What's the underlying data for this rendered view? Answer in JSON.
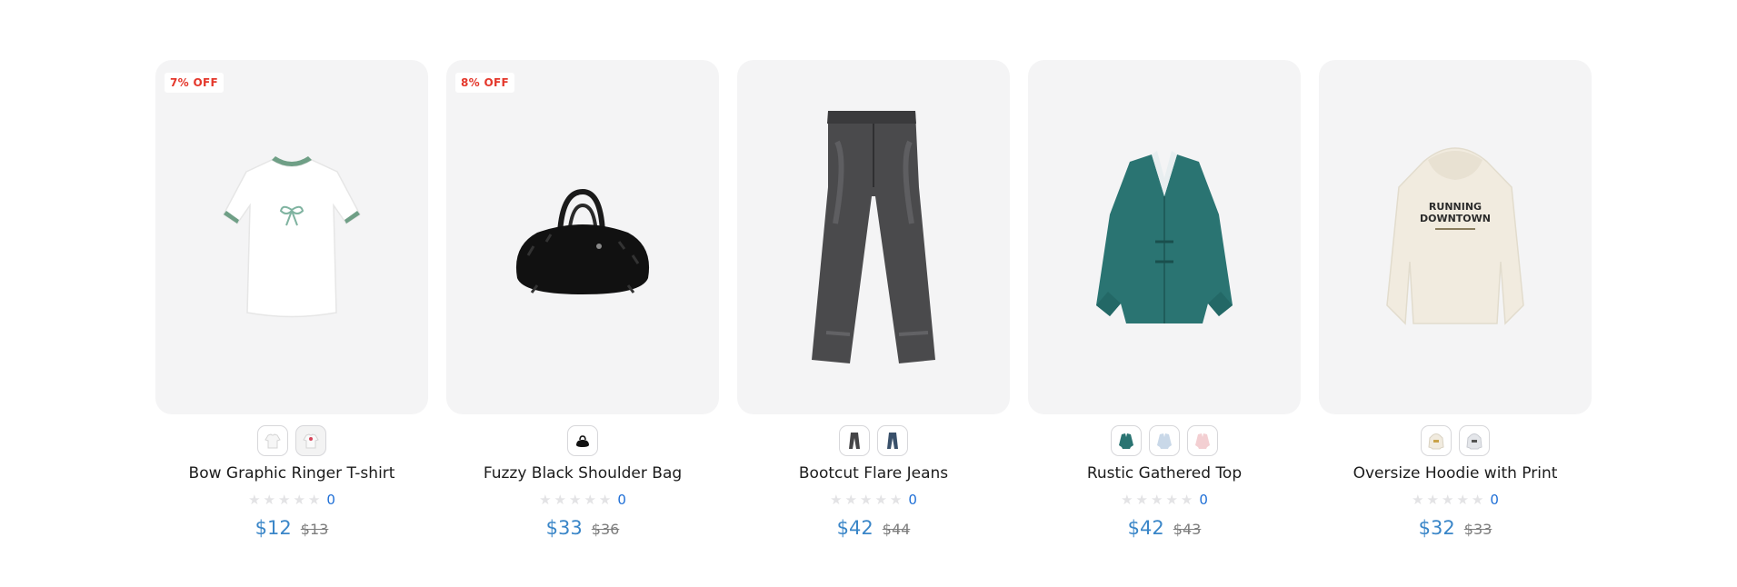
{
  "products": [
    {
      "badge": "7% OFF",
      "title": "Bow Graphic Ringer T-shirt",
      "rating_count": "0",
      "price": "$12",
      "old_price": "$13",
      "swatches": [
        "white-tshirt-swatch-icon",
        "white-print-tshirt-swatch-icon"
      ]
    },
    {
      "badge": "8% OFF",
      "title": "Fuzzy Black Shoulder Bag",
      "rating_count": "0",
      "price": "$33",
      "old_price": "$36",
      "swatches": [
        "black-bag-swatch-icon"
      ]
    },
    {
      "badge": "",
      "title": "Bootcut Flare Jeans",
      "rating_count": "0",
      "price": "$42",
      "old_price": "$44",
      "swatches": [
        "grey-jeans-swatch-icon",
        "blue-jeans-swatch-icon"
      ]
    },
    {
      "badge": "",
      "title": "Rustic Gathered Top",
      "rating_count": "0",
      "price": "$42",
      "old_price": "$43",
      "swatches": [
        "teal-top-swatch-icon",
        "light-blue-top-swatch-icon",
        "pink-top-swatch-icon"
      ]
    },
    {
      "badge": "",
      "title": "Oversize Hoodie with Print",
      "rating_count": "0",
      "price": "$32",
      "old_price": "$33",
      "swatches": [
        "cream-hoodie-swatch-icon",
        "grey-hoodie-swatch-icon"
      ],
      "photo_print_text": [
        "RUNNING",
        "DOWNTOWN"
      ]
    }
  ],
  "colors": {
    "card_bg": "#f4f4f5",
    "badge_text": "#e4372b",
    "price": "#3a86c8",
    "old_price": "#7d7d7d",
    "rating_count": "#1f6fd6",
    "star_empty": "#e3e3e5"
  }
}
